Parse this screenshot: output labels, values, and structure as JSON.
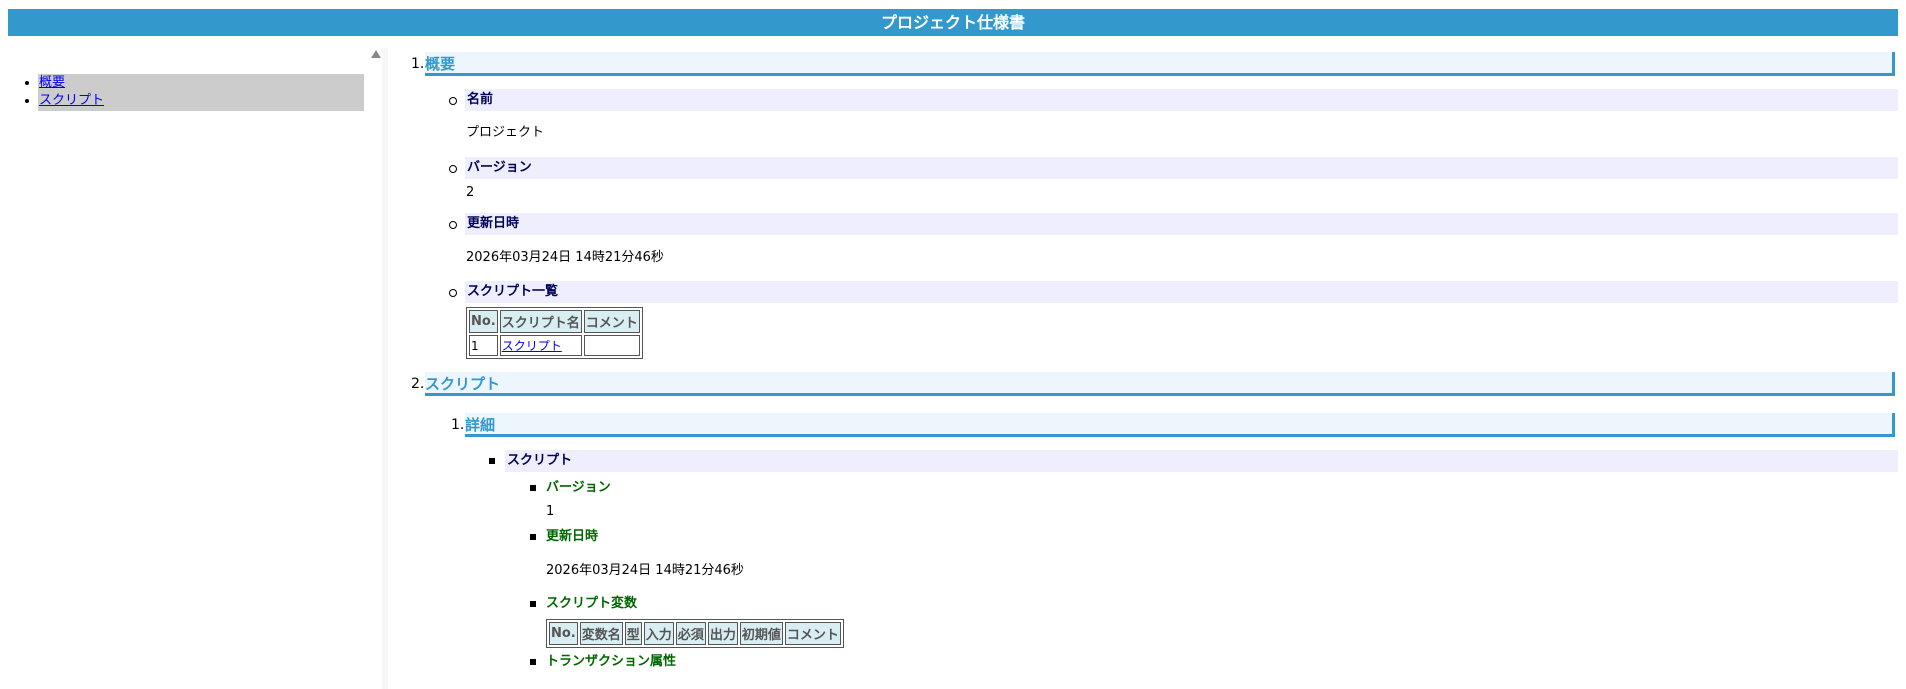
{
  "page_title": "プロジェクト仕様書",
  "toc": [
    {
      "label": "概要"
    },
    {
      "label": "スクリプト"
    }
  ],
  "sections": {
    "overview": {
      "num": "1.",
      "title": "概要",
      "name_label": "名前",
      "name_value": "プロジェクト",
      "version_label": "バージョン",
      "version_value": "2",
      "updated_label": "更新日時",
      "updated_value": "2026年03月24日 14時21分46秒",
      "script_list_label": "スクリプト一覧",
      "script_table": {
        "headers": [
          "No.",
          "スクリプト名",
          "コメント"
        ],
        "rows": [
          [
            "1",
            "スクリプト",
            ""
          ]
        ]
      }
    },
    "script": {
      "num": "2.",
      "title": "スクリプト",
      "detail_num": "1.",
      "detail_title": "詳細",
      "item_title": "スクリプト",
      "version_label": "バージョン",
      "version_value": "1",
      "updated_label": "更新日時",
      "updated_value": "2026年03月24日 14時21分46秒",
      "vars_label": "スクリプト変数",
      "vars_table": {
        "headers": [
          "No.",
          "変数名",
          "型",
          "入力",
          "必須",
          "出力",
          "初期値",
          "コメント"
        ]
      },
      "tx_label": "トランザクション属性"
    }
  }
}
